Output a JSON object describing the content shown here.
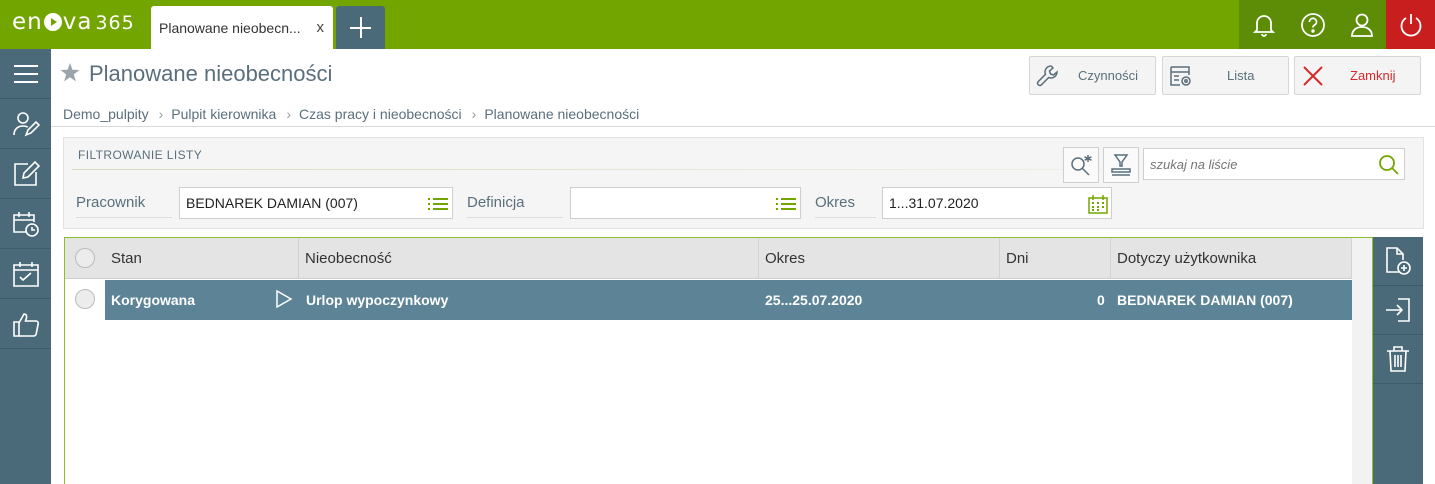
{
  "app": {
    "logo_text": "en",
    "logo_text2": "va",
    "logo_num": "365",
    "active_tab": "Planowane nieobecn...",
    "tab_close": "x"
  },
  "header": {
    "title": "Planowane nieobecności",
    "buttons": {
      "actions": "Czynności",
      "list": "Lista",
      "close": "Zamknij"
    },
    "breadcrumb": [
      "Demo_pulpity",
      "Pulpit kierownika",
      "Czas pracy i nieobecności",
      "Planowane nieobecności"
    ]
  },
  "filter": {
    "title": "FILTROWANIE LISTY",
    "search_placeholder": "szukaj na liście",
    "employee_label": "Pracownik",
    "employee_value": "BEDNAREK DAMIAN (007)",
    "definition_label": "Definicja",
    "definition_value": "",
    "period_label": "Okres",
    "period_value": "1...31.07.2020"
  },
  "grid": {
    "columns": [
      "Stan",
      "Nieobecność",
      "Okres",
      "Dni",
      "Dotyczy użytkownika"
    ],
    "rows": [
      {
        "state": "Korygowana",
        "absence": "Urlop wypoczynkowy",
        "period": "25...25.07.2020",
        "days": "0",
        "user": "BEDNAREK DAMIAN (007)"
      }
    ]
  },
  "colors": {
    "topbar": "#73a500",
    "sidebar": "#4a6a7a",
    "selected_row": "#5c8496",
    "power": "#c81e1e",
    "accent_green": "#8bbf2d",
    "close_red": "#d42a2a"
  },
  "icons": {
    "topbar": [
      "bell-icon",
      "help-icon",
      "user-icon",
      "power-icon"
    ],
    "sidebar": [
      "menu-icon",
      "user-edit-icon",
      "edit-icon",
      "calendar-clock-icon",
      "calendar-check-icon",
      "thumbs-up-icon"
    ],
    "right": [
      "new-document-icon",
      "sign-in-icon",
      "trash-icon"
    ]
  }
}
